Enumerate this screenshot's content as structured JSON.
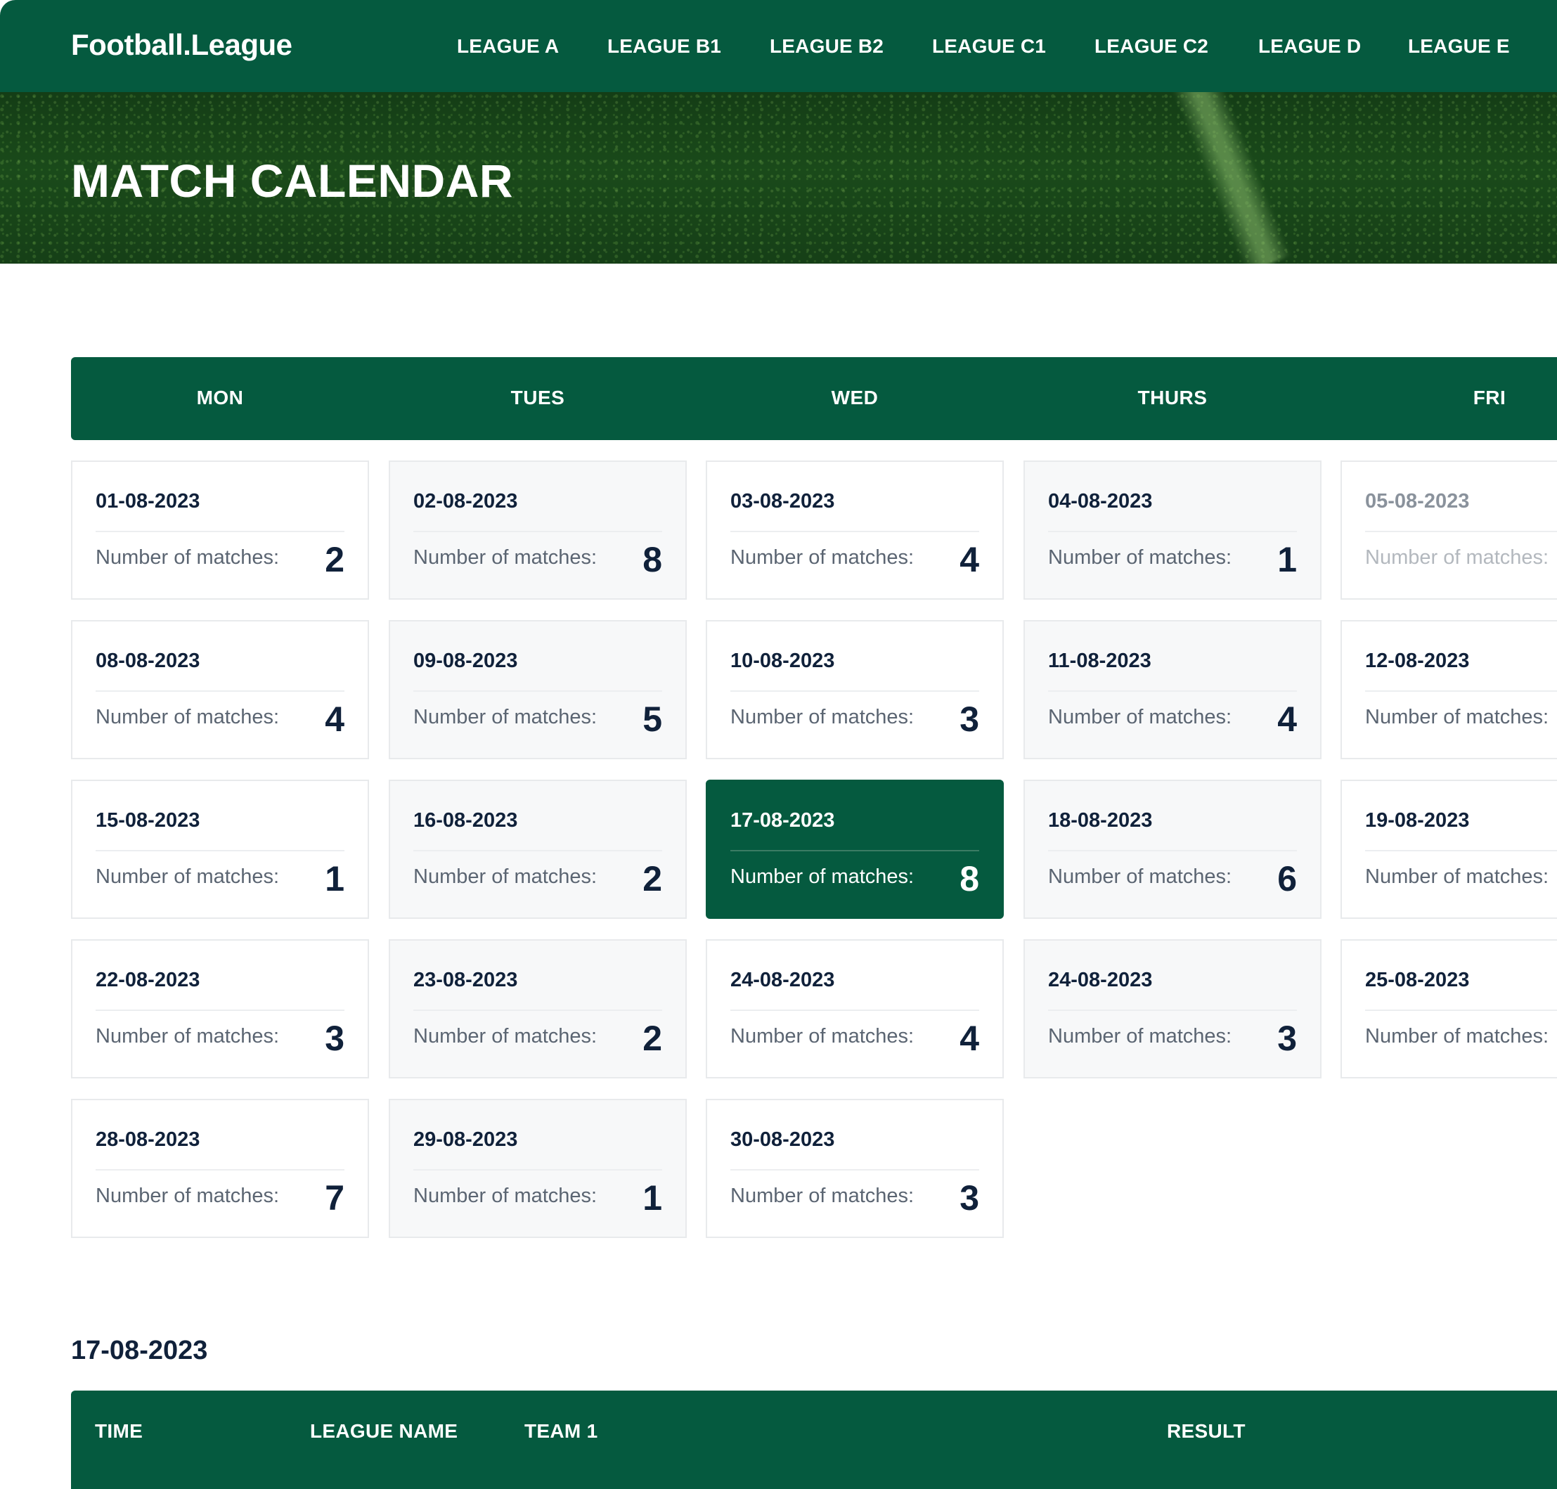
{
  "app": {
    "logo": "Football.League"
  },
  "nav": {
    "items": [
      {
        "label": "LEAGUE A"
      },
      {
        "label": "LEAGUE B1"
      },
      {
        "label": "LEAGUE B2"
      },
      {
        "label": "LEAGUE C1"
      },
      {
        "label": "LEAGUE C2"
      },
      {
        "label": "LEAGUE D"
      },
      {
        "label": "LEAGUE E"
      }
    ]
  },
  "hero": {
    "title": "MATCH CALENDAR"
  },
  "calendar": {
    "weekdays": [
      "MON",
      "TUES",
      "WED",
      "THURS",
      "FRI"
    ],
    "count_label": "Number of matches:",
    "rows": [
      [
        {
          "date": "01-08-2023",
          "count": "2"
        },
        {
          "date": "02-08-2023",
          "count": "8"
        },
        {
          "date": "03-08-2023",
          "count": "4"
        },
        {
          "date": "04-08-2023",
          "count": "1"
        },
        {
          "date": "05-08-2023",
          "count": "",
          "faded": true
        }
      ],
      [
        {
          "date": "08-08-2023",
          "count": "4"
        },
        {
          "date": "09-08-2023",
          "count": "5"
        },
        {
          "date": "10-08-2023",
          "count": "3"
        },
        {
          "date": "11-08-2023",
          "count": "4"
        },
        {
          "date": "12-08-2023",
          "count": ""
        }
      ],
      [
        {
          "date": "15-08-2023",
          "count": "1"
        },
        {
          "date": "16-08-2023",
          "count": "2"
        },
        {
          "date": "17-08-2023",
          "count": "8",
          "selected": true
        },
        {
          "date": "18-08-2023",
          "count": "6"
        },
        {
          "date": "19-08-2023",
          "count": ""
        }
      ],
      [
        {
          "date": "22-08-2023",
          "count": "3"
        },
        {
          "date": "23-08-2023",
          "count": "2"
        },
        {
          "date": "24-08-2023",
          "count": "4"
        },
        {
          "date": "24-08-2023",
          "count": "3"
        },
        {
          "date": "25-08-2023",
          "count": ""
        }
      ],
      [
        {
          "date": "28-08-2023",
          "count": "7"
        },
        {
          "date": "29-08-2023",
          "count": "1"
        },
        {
          "date": "30-08-2023",
          "count": "3"
        }
      ]
    ]
  },
  "detail": {
    "selected_date": "17-08-2023",
    "columns": [
      "TIME",
      "LEAGUE NAME",
      "TEAM 1",
      "RESULT"
    ]
  },
  "colors": {
    "brand_green": "#055a3f",
    "text_dark": "#10213a",
    "text_muted": "#5b6572"
  }
}
